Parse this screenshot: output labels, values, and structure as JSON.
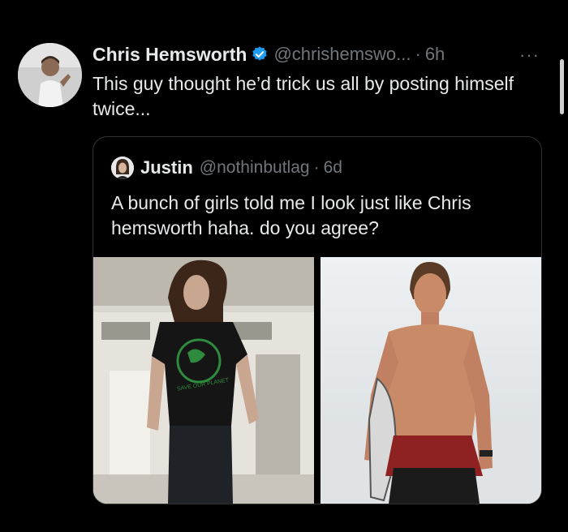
{
  "tweet": {
    "author_name": "Chris Hemsworth",
    "handle": "@chrishemswo...",
    "separator": "·",
    "time": "6h",
    "more_icon": "more-dots-icon",
    "text": "This guy thought he’d trick us all by posting himself twice..."
  },
  "quote": {
    "author_name": "Justin",
    "handle": "@nothinbutlag",
    "separator": "·",
    "time": "6d",
    "text": "A bunch of girls told me I look just like Chris hemsworth haha. do you agree?",
    "shirt_print": "SAVE OUR PLANET"
  },
  "colors": {
    "background": "#000000",
    "text": "#e7e9ea",
    "muted": "#71767b",
    "verified": "#1d9bf0",
    "border": "#2f3336"
  }
}
